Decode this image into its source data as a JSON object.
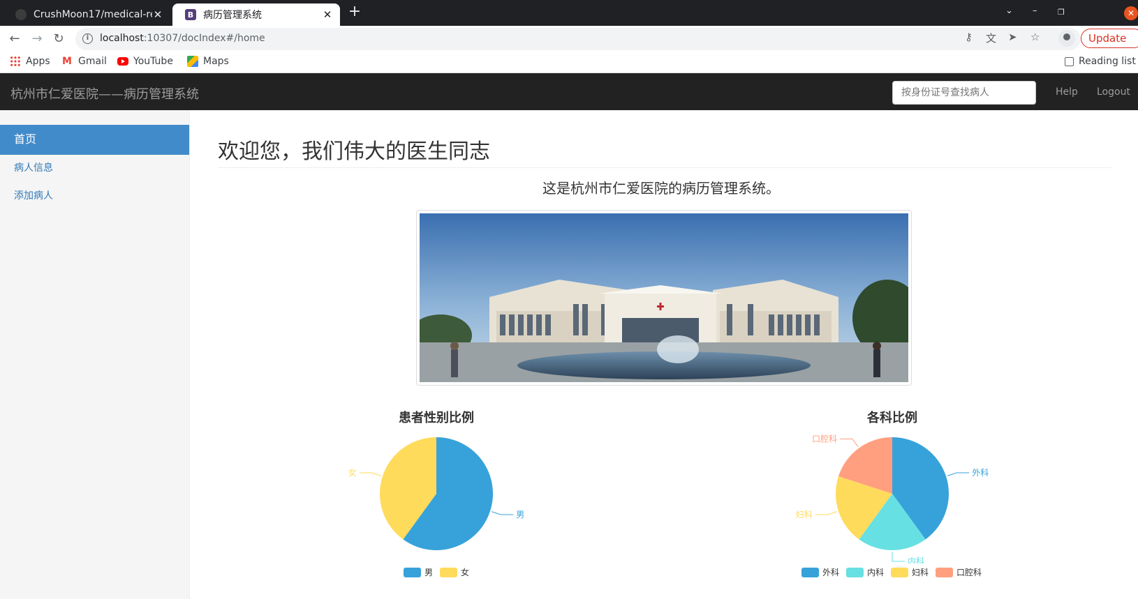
{
  "browser": {
    "tabs": [
      {
        "title": "CrushMoon17/medical-re",
        "active": false,
        "favicon": "github-icon"
      },
      {
        "title": "病历管理系统",
        "active": true,
        "favicon": "bootstrap-icon",
        "favicon_letter": "B"
      }
    ],
    "url": {
      "host": "localhost",
      "rest": ":10307/docIndex#/home"
    },
    "update_label": "Update",
    "bookmarks": [
      {
        "label": "Apps",
        "icon": "apps-grid-icon"
      },
      {
        "label": "Gmail",
        "icon": "gmail-icon"
      },
      {
        "label": "YouTube",
        "icon": "youtube-icon"
      },
      {
        "label": "Maps",
        "icon": "maps-icon"
      }
    ],
    "reading_list": "Reading list"
  },
  "app": {
    "brand": "杭州市仁爱医院——病历管理系统",
    "search_placeholder": "按身份证号查找病人",
    "nav": {
      "help": "Help",
      "logout": "Logout"
    },
    "sidebar": [
      {
        "label": "首页",
        "active": true
      },
      {
        "label": "病人信息",
        "active": false
      },
      {
        "label": "添加病人",
        "active": false
      }
    ],
    "main": {
      "title": "欢迎您，我们伟大的医生同志",
      "subtitle": "这是杭州市仁爱医院的病历管理系统。"
    }
  },
  "chart_data": [
    {
      "type": "pie",
      "title": "患者性别比例",
      "categories": [
        "男",
        "女"
      ],
      "values": [
        60,
        40
      ],
      "colors": [
        "#37a2da",
        "#ffdb5c"
      ],
      "legend": "bottom"
    },
    {
      "type": "pie",
      "title": "各科比例",
      "categories": [
        "外科",
        "内科",
        "妇科",
        "口腔科"
      ],
      "values": [
        40,
        20,
        20,
        20
      ],
      "colors": [
        "#37a2da",
        "#67e0e3",
        "#ffdb5c",
        "#ff9f7f"
      ],
      "legend": "bottom"
    }
  ]
}
